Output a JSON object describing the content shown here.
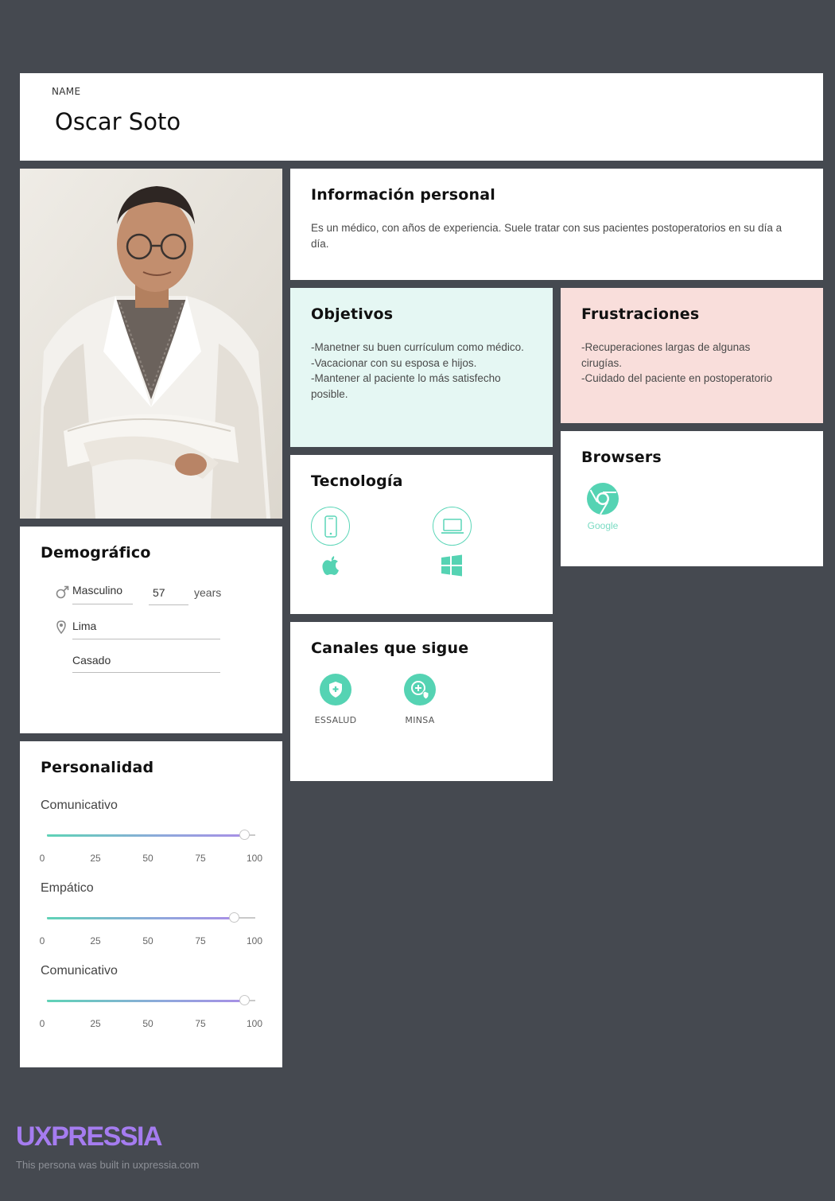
{
  "name_card": {
    "label": "NAME",
    "value": "Oscar Soto"
  },
  "personal_info": {
    "title": "Información personal",
    "text": "Es un médico, con años de experiencia. Suele tratar con sus pacientes postoperatorios en su día a día."
  },
  "goals": {
    "title": "Objetivos",
    "lines": [
      "-Manetner su buen currículum como médico.",
      "-Vacacionar con su esposa e hijos.",
      "-Mantener al paciente lo más satisfecho posible."
    ]
  },
  "frustrations": {
    "title": "Frustraciones",
    "lines": [
      "-Recuperaciones largas de algunas cirugías.",
      "-Cuidado del paciente en postoperatorio"
    ]
  },
  "technology": {
    "title": "Tecnología",
    "icons": [
      "smartphone-icon",
      "laptop-icon",
      "apple-icon",
      "windows-icon"
    ]
  },
  "browsers": {
    "title": "Browsers",
    "items": [
      {
        "label": "Google",
        "icon": "chrome-icon"
      }
    ]
  },
  "channels": {
    "title": "Canales que sigue",
    "items": [
      {
        "label": "ESSALUD",
        "icon": "shield-plus-icon"
      },
      {
        "label": "MINSA",
        "icon": "health-search-icon"
      }
    ]
  },
  "demographic": {
    "title": "Demográfico",
    "gender": "Masculino",
    "age": "57",
    "age_unit": "years",
    "location": "Lima",
    "status": "Casado"
  },
  "personality": {
    "title": "Personalidad",
    "ticks": [
      "0",
      "25",
      "50",
      "75",
      "100"
    ],
    "traits": [
      {
        "label": "Comunicativo",
        "value": 95
      },
      {
        "label": "Empático",
        "value": 90
      },
      {
        "label": "Comunicativo",
        "value": 95
      }
    ]
  },
  "footer": {
    "brand": "UXPRESSIA",
    "note": "This persona was built in uxpressia.com"
  },
  "colors": {
    "background": "#454950",
    "accent": "#55d3b3",
    "goals_bg": "#e5f7f3",
    "frustrations_bg": "#f9dedb",
    "brand": "#a57cf0"
  }
}
